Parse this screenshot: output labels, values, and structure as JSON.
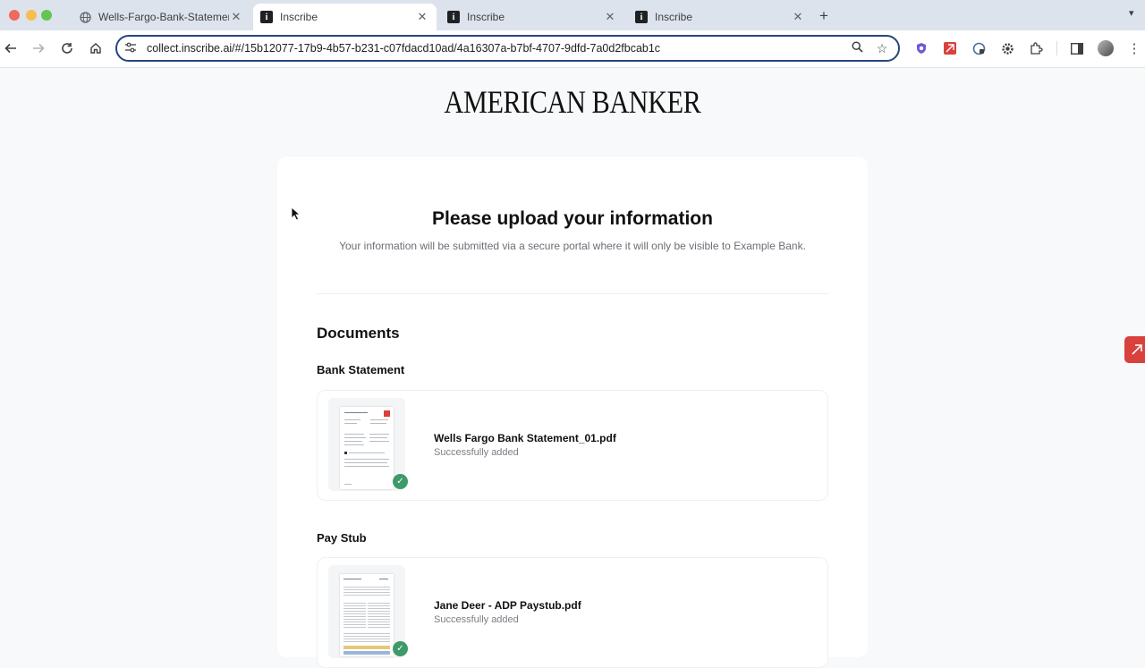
{
  "browser": {
    "tabs": [
      {
        "title": "Wells-Fargo-Bank-Statement",
        "favicon": "globe-icon",
        "active": false
      },
      {
        "title": "Inscribe",
        "favicon": "inscribe-favicon",
        "active": true
      },
      {
        "title": "Inscribe",
        "favicon": "inscribe-favicon",
        "active": false
      },
      {
        "title": "Inscribe",
        "favicon": "inscribe-favicon",
        "active": false
      }
    ],
    "url": "collect.inscribe.ai/#/15b12077-17b9-4b57-b231-c07fdacd10ad/4a16307a-b7bf-4707-9dfd-7a0d2fbcab1c"
  },
  "page": {
    "logo": "AMERICAN BANKER",
    "heading": "Please upload your information",
    "subheading": "Your information will be submitted via a secure portal where it will only be visible to Example Bank.",
    "documents_title": "Documents",
    "sections": [
      {
        "label": "Bank Statement",
        "file": {
          "name": "Wells Fargo Bank Statement_01.pdf",
          "status": "Successfully added"
        }
      },
      {
        "label": "Pay Stub",
        "file": {
          "name": "Jane Deer - ADP Paystub.pdf",
          "status": "Successfully added"
        }
      }
    ]
  },
  "colors": {
    "success": "#3e9a68",
    "omnibox_border": "#26467e",
    "side_button": "#d9413d"
  }
}
